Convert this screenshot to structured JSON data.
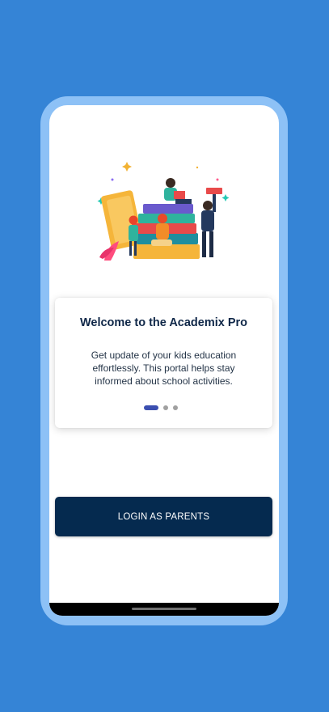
{
  "onboarding": {
    "title": "Welcome to the Academix Pro",
    "description": "Get update of your kids education effortlessly. This portal helps stay informed about school activities.",
    "pager": {
      "total_pages": 3,
      "current_page": 1
    },
    "illustration_icon": "kids-reading-books-illustration"
  },
  "actions": {
    "login_parents_label": "LOGIN AS PARENTS"
  },
  "colors": {
    "background": "#3584d6",
    "frame": "#8dc1f6",
    "primary_button": "#052a4f",
    "title_text": "#0f2748",
    "pager_active": "#3b4fb0",
    "pager_inactive": "#a0a0a0"
  }
}
